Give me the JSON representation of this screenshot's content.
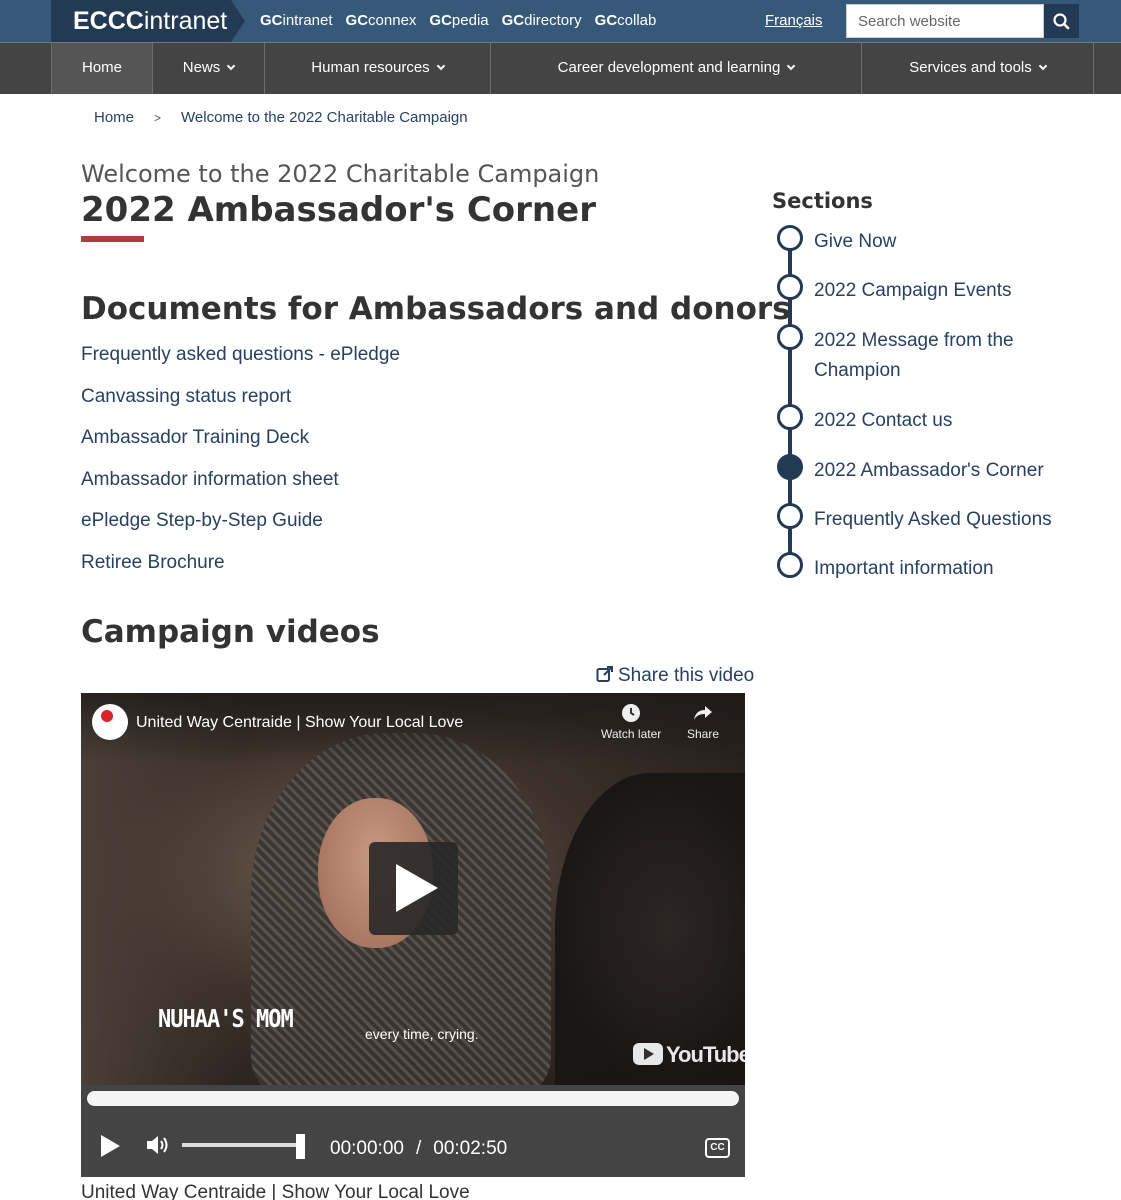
{
  "header": {
    "brand_bold": "ECCC",
    "brand_rest": "intranet",
    "gc_links": [
      {
        "prefix": "GC",
        "label": "intranet"
      },
      {
        "prefix": "GC",
        "label": "connex"
      },
      {
        "prefix": "GC",
        "label": "pedia"
      },
      {
        "prefix": "GC",
        "label": "directory"
      },
      {
        "prefix": "GC",
        "label": "collab"
      }
    ],
    "language_toggle": "Français",
    "search_placeholder": "Search website"
  },
  "main_nav": [
    {
      "label": "Home",
      "has_menu": false,
      "active": true
    },
    {
      "label": "News",
      "has_menu": true
    },
    {
      "label": "Human resources",
      "has_menu": true
    },
    {
      "label": "Career development and learning",
      "has_menu": true
    },
    {
      "label": "Services and tools",
      "has_menu": true
    }
  ],
  "breadcrumb": [
    {
      "label": "Home"
    },
    {
      "label": "Welcome to the 2022 Charitable Campaign"
    }
  ],
  "breadcrumb_separator": ">",
  "page": {
    "pre_title": "Welcome to the 2022 Charitable Campaign",
    "title": "2022 Ambassador's Corner",
    "accent_color": "#af3c43"
  },
  "documents": {
    "heading": "Documents for Ambassadors and donors",
    "links": [
      "Frequently asked questions - ePledge",
      "Canvassing status report",
      "Ambassador Training Deck",
      "Ambassador information sheet",
      "ePledge Step-by-Step Guide",
      "Retiree Brochure"
    ]
  },
  "sections": {
    "heading": "Sections",
    "items": [
      {
        "label": "Give Now",
        "current": false
      },
      {
        "label": "2022 Campaign Events",
        "current": false
      },
      {
        "label": "2022 Message from the Champion",
        "current": false
      },
      {
        "label": "2022 Contact us",
        "current": false
      },
      {
        "label": "2022 Ambassador's Corner",
        "current": true
      },
      {
        "label": "Frequently Asked Questions",
        "current": false
      },
      {
        "label": "Important information",
        "current": false
      }
    ]
  },
  "videos": {
    "heading": "Campaign videos",
    "share_label": "Share this video",
    "youtube_title": "United Way Centraide | Show Your Local Love",
    "watch_later_label": "Watch later",
    "share_action_label": "Share",
    "overlay_name": "NUHAA'S MOM",
    "subtitle_text": "every time, crying.",
    "youtube_wordmark": "YouTube",
    "current_time": "00:00:00",
    "time_separator": "/",
    "duration": "00:02:50",
    "cc_label": "CC",
    "caption": "United Way Centraide | Show Your Local Love"
  },
  "colors": {
    "top_bar": "#36597a",
    "brand_box": "#233a55",
    "nav_bar": "#444444",
    "link": "#284162"
  }
}
